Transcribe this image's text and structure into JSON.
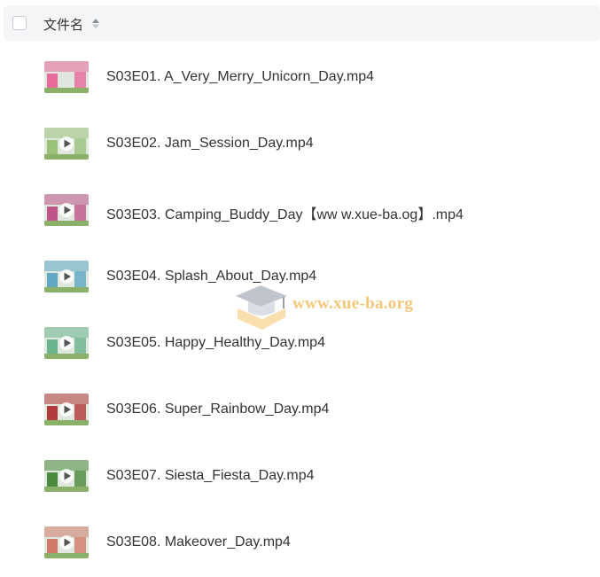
{
  "header": {
    "column_title": "文件名",
    "sort_icon": "sort-icon"
  },
  "files": [
    {
      "name": "S03E01. A_Very_Merry_Unicorn_Day.mp4",
      "thumb_color": "#e86a9a",
      "play": false
    },
    {
      "name": "S03E02. Jam_Session_Day.mp4",
      "thumb_color": "#9ac27a",
      "play": true
    },
    {
      "name": "S03E03. Camping_Buddy_Day【ww w.xue-ba.og】.mp4",
      "thumb_color": "#c0558a",
      "play": true
    },
    {
      "name": "S03E04. Splash_About_Day.mp4",
      "thumb_color": "#5fa9c4",
      "play": true
    },
    {
      "name": "S03E05. Happy_Healthy_Day.mp4",
      "thumb_color": "#69b48c",
      "play": true
    },
    {
      "name": "S03E06. Super_Rainbow_Day.mp4",
      "thumb_color": "#b23a3a",
      "play": true
    },
    {
      "name": "S03E07. Siesta_Fiesta_Day.mp4",
      "thumb_color": "#4a8a3c",
      "play": true
    },
    {
      "name": "S03E08. Makeover_Day.mp4",
      "thumb_color": "#d27a6a",
      "play": true
    }
  ],
  "watermark": {
    "text": "www.xue-ba.org",
    "icon": "graduation-cap-icon"
  }
}
